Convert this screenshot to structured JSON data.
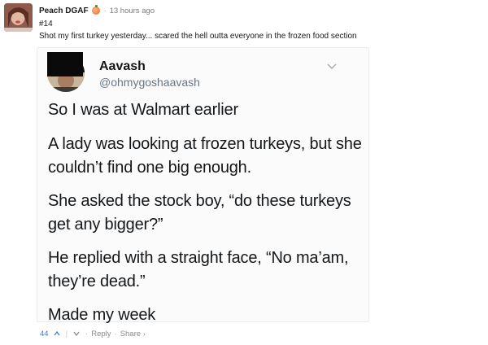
{
  "post": {
    "username": "Peach DGAF",
    "flair_icon": "peach-icon",
    "separator": "·",
    "timestamp": "13 hours ago",
    "number": "#14",
    "caption": "Shot my first turkey yesterday... scared the hell outta everyone in the frozen food section"
  },
  "tweet": {
    "name": "Aavash",
    "handle": "@ohmygoshaavash",
    "lines": [
      "So I was at Walmart earlier",
      "A lady was looking at frozen turkeys, but she couldn’t find one big enough.",
      "She asked the stock boy, “do these turkeys get any bigger?”",
      "He replied with a straight face, “No ma’am, they’re dead.”",
      "Made my week"
    ]
  },
  "actions": {
    "score": "44",
    "separator": "|",
    "reply": "Reply",
    "dot": "·",
    "share": "Share",
    "share_chevron": "›"
  },
  "colors": {
    "score": "#3d7ed6",
    "tweet_name": "#14171a",
    "tweet_handle": "#657786"
  }
}
